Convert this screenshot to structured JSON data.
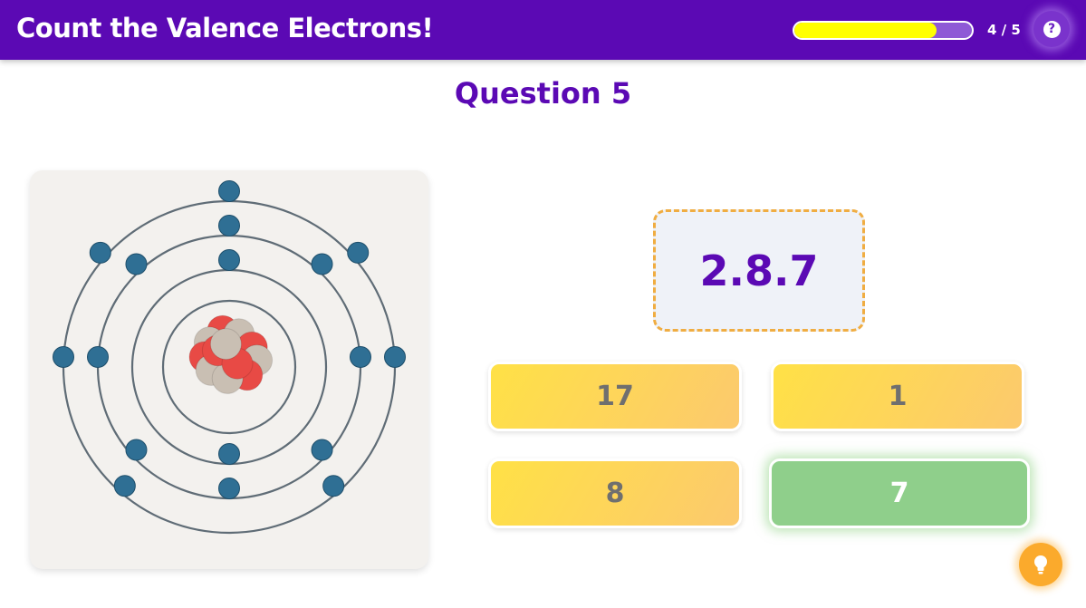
{
  "header": {
    "title": "Count the Valence Electrons!",
    "progress_text": "4 / 5",
    "progress_fraction": 0.8,
    "help_icon": "?"
  },
  "question": {
    "title": "Question 5",
    "configuration": "2.8.7"
  },
  "atom": {
    "shell_electron_counts": [
      2,
      8,
      7
    ],
    "shells_drawn": 4
  },
  "answers": [
    {
      "label": "17",
      "state": "default"
    },
    {
      "label": "1",
      "state": "default"
    },
    {
      "label": "8",
      "state": "default"
    },
    {
      "label": "7",
      "state": "correct"
    }
  ],
  "icons": {
    "help": "question-mark-icon",
    "hint": "lightbulb-icon"
  },
  "colors": {
    "header_bg": "#5b09b4",
    "progress_fill": "#ffff00",
    "answer_default": "#ffd85a",
    "answer_correct": "#8fcf8b",
    "config_border": "#f0ad42",
    "electron": "#2f6f94",
    "proton": "#e84a45",
    "neutron": "#c9bfb3"
  }
}
